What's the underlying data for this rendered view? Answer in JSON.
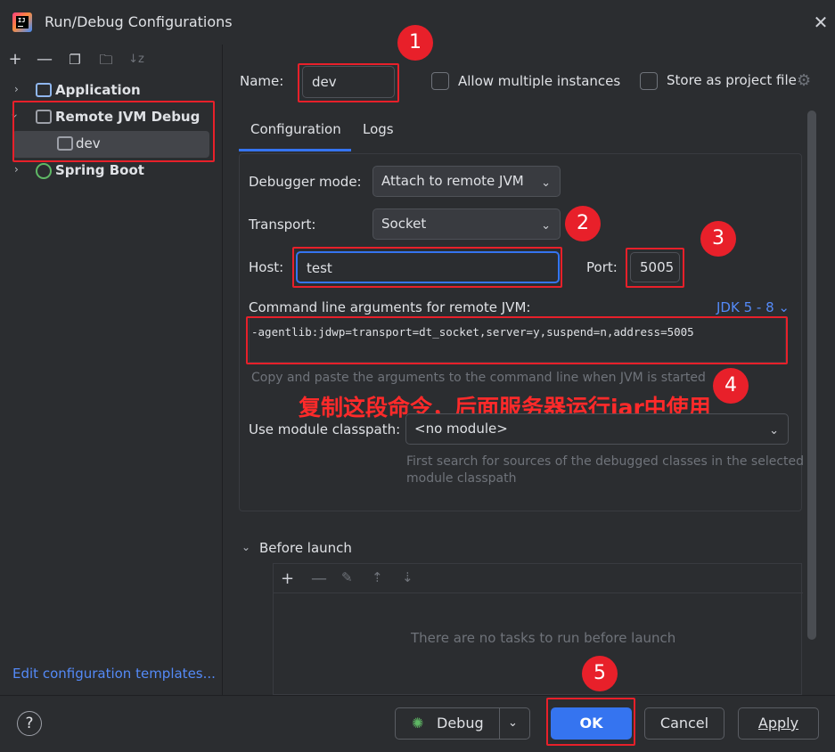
{
  "window": {
    "title": "Run/Debug Configurations",
    "app_icon_text": "IJ"
  },
  "sidebar": {
    "items": [
      {
        "label": "Application",
        "icon": "application-config-icon",
        "expanded": false
      },
      {
        "label": "Remote JVM Debug",
        "icon": "remote-debug-config-icon",
        "expanded": true
      },
      {
        "label": "dev",
        "icon": "remote-debug-config-icon",
        "child": true,
        "selected": true
      },
      {
        "label": "Spring Boot",
        "icon": "spring-boot-icon",
        "expanded": false
      }
    ],
    "edit_templates": "Edit configuration templates..."
  },
  "form": {
    "name_label": "Name:",
    "name_value": "dev",
    "allow_multiple": "Allow multiple instances",
    "store_as_project": "Store as project file",
    "tabs": [
      "Configuration",
      "Logs"
    ],
    "debugger_mode_label": "Debugger mode:",
    "debugger_mode_value": "Attach to remote JVM",
    "transport_label": "Transport:",
    "transport_value": "Socket",
    "host_label": "Host:",
    "host_value": "test",
    "port_label": "Port:",
    "port_value": "5005",
    "cmd_label": "Command line arguments for remote JVM:",
    "jdk_selector": "JDK 5 - 8",
    "cmd_value": "-agentlib:jdwp=transport=dt_socket,server=y,suspend=n,address=5005",
    "cmd_hint": "Copy and paste the arguments to the command line when JVM is started",
    "module_label": "Use module classpath:",
    "module_value": "<no module>",
    "module_hint_1": "First search for sources of the debugged classes in the selected",
    "module_hint_2": "module classpath",
    "before_launch": "Before launch",
    "no_tasks": "There are no tasks to run before launch"
  },
  "annotation": {
    "badges": [
      "1",
      "2",
      "3",
      "4",
      "5"
    ],
    "note": "复制这段命令，后面服务器运行jar中使用",
    "color": "#e8202a"
  },
  "buttons": {
    "debug": "Debug",
    "ok": "OK",
    "cancel": "Cancel",
    "apply": "Apply"
  },
  "colors": {
    "accent": "#3574f0",
    "link": "#548af7",
    "background": "#2b2d30"
  }
}
